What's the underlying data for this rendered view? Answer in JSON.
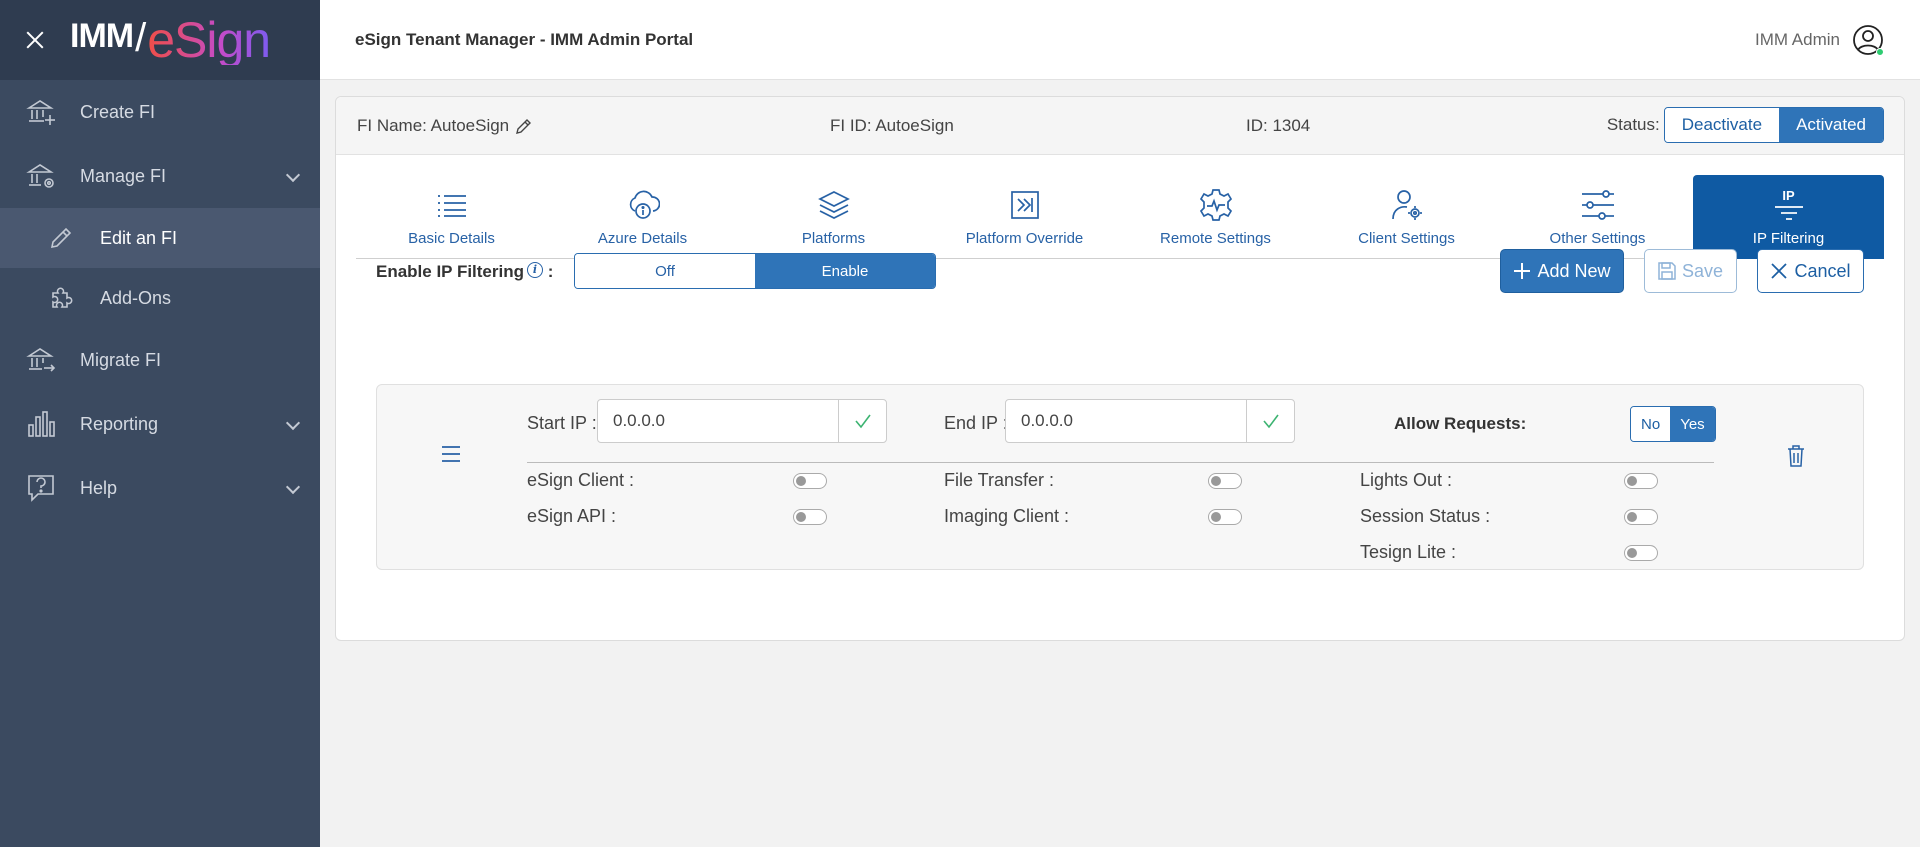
{
  "sidebar": {
    "logo": {
      "imm": "IMM",
      "slash": "/",
      "esign": "eSign"
    },
    "items": [
      {
        "label": "Create FI",
        "icon": "bank-plus-icon"
      },
      {
        "label": "Manage FI",
        "icon": "bank-gear-icon"
      },
      {
        "label": "Edit an FI",
        "icon": "pencil-icon"
      },
      {
        "label": "Add-Ons",
        "icon": "puzzle-icon"
      },
      {
        "label": "Migrate FI",
        "icon": "bank-arrow-icon"
      },
      {
        "label": "Reporting",
        "icon": "bar-chart-icon"
      },
      {
        "label": "Help",
        "icon": "help-icon"
      }
    ]
  },
  "header": {
    "title": "eSign Tenant Manager - IMM Admin Portal",
    "user": "IMM Admin"
  },
  "card": {
    "fi_name": "FI Name: AutoeSign",
    "fi_id": "FI ID: AutoeSign",
    "id": "ID: 1304",
    "status_label": "Status:",
    "deactivate": "Deactivate",
    "activated": "Activated"
  },
  "tabs": [
    {
      "label": "Basic Details",
      "icon": "list-icon"
    },
    {
      "label": "Azure Details",
      "icon": "cloud-info-icon"
    },
    {
      "label": "Platforms",
      "icon": "layers-icon"
    },
    {
      "label": "Platform Override",
      "icon": "arrow-box-icon"
    },
    {
      "label": "Remote Settings",
      "icon": "gear-pulse-icon"
    },
    {
      "label": "Client Settings",
      "icon": "user-gear-icon"
    },
    {
      "label": "Other Settings",
      "icon": "sliders-icon"
    },
    {
      "label": "IP Filtering",
      "icon": "ip-filter-icon",
      "icon_text": "IP"
    }
  ],
  "ip_filtering": {
    "enable_label": "Enable IP Filtering",
    "info_glyph": "i",
    "colon": ":",
    "off_label": "Off",
    "enable_option": "Enable",
    "add_new": "Add New",
    "save": "Save",
    "cancel": "Cancel"
  },
  "rule": {
    "start_ip_label": "Start IP :",
    "start_ip_value": "0.0.0.0",
    "end_ip_label": "End IP :",
    "end_ip_value": "0.0.0.0",
    "allow_label": "Allow Requests:",
    "no": "No",
    "yes": "Yes",
    "options": {
      "esign_client": "eSign Client :",
      "esign_api": "eSign API :",
      "file_transfer": "File Transfer :",
      "imaging_client": "Imaging Client :",
      "lights_out": "Lights Out :",
      "session_status": "Session Status :",
      "tesign_lite": "Tesign Lite :"
    }
  }
}
